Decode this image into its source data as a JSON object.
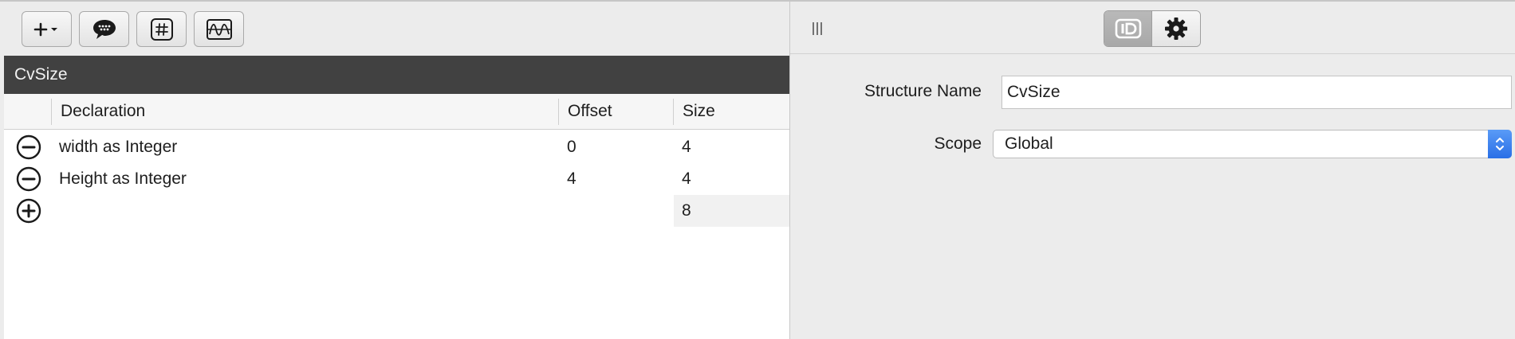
{
  "toolbar": {
    "buttons": [
      {
        "icon": "add-menu-icon"
      },
      {
        "icon": "speech-bubble-icon"
      },
      {
        "icon": "hash-icon"
      },
      {
        "icon": "waveform-icon"
      }
    ]
  },
  "structure": {
    "title": "CvSize",
    "columns": {
      "declaration": "Declaration",
      "offset": "Offset",
      "size": "Size"
    },
    "rows": [
      {
        "declaration": "width as Integer",
        "offset": "0",
        "size": "4"
      },
      {
        "declaration": "Height as Integer",
        "offset": "4",
        "size": "4"
      }
    ],
    "total_size": "8"
  },
  "inspector": {
    "tabs": [
      {
        "icon": "id-icon",
        "active": true
      },
      {
        "icon": "gear-icon",
        "active": false
      }
    ],
    "structure_name_label": "Structure Name",
    "structure_name_value": "CvSize",
    "scope_label": "Scope",
    "scope_value": "Global"
  },
  "colors": {
    "title_bar": "#414141",
    "select_accent": "#2a6fe6"
  }
}
